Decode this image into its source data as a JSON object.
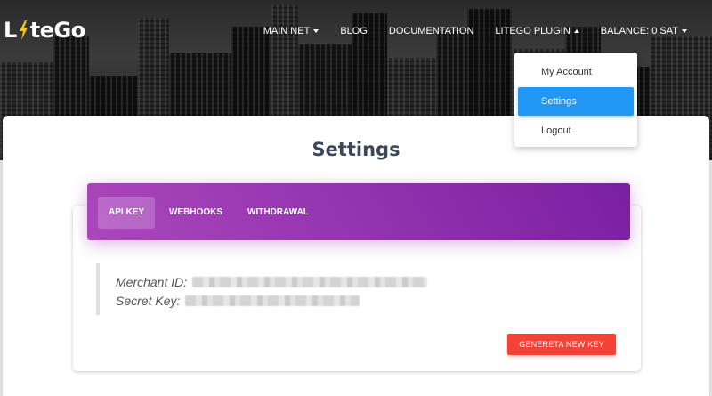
{
  "brand": {
    "name_prefix": "L",
    "name_suffix": "teGo"
  },
  "nav": {
    "items": [
      {
        "label": "MAIN NET",
        "has_caret": true
      },
      {
        "label": "BLOG"
      },
      {
        "label": "DOCUMENTATION"
      },
      {
        "label": "LITEGO PLUGIN",
        "has_caret": true,
        "open": true
      },
      {
        "label": "BALANCE: 0 SAT",
        "has_caret": true
      }
    ]
  },
  "dropdown": {
    "items": [
      {
        "label": "My Account"
      },
      {
        "label": "Settings",
        "active": true
      },
      {
        "label": "Logout"
      }
    ]
  },
  "page": {
    "title": "Settings"
  },
  "tabs": [
    {
      "label": "API KEY",
      "active": true
    },
    {
      "label": "WEBHOOKS"
    },
    {
      "label": "WITHDRAWAL"
    }
  ],
  "keys": {
    "merchant_label": "Merchant ID:",
    "secret_label": "Secret Key:"
  },
  "actions": {
    "generate_label": "GENERETA NEW KEY"
  },
  "colors": {
    "accent_purple": "#9c27b0",
    "button_red": "#f44336",
    "dropdown_active": "#2196f3"
  }
}
